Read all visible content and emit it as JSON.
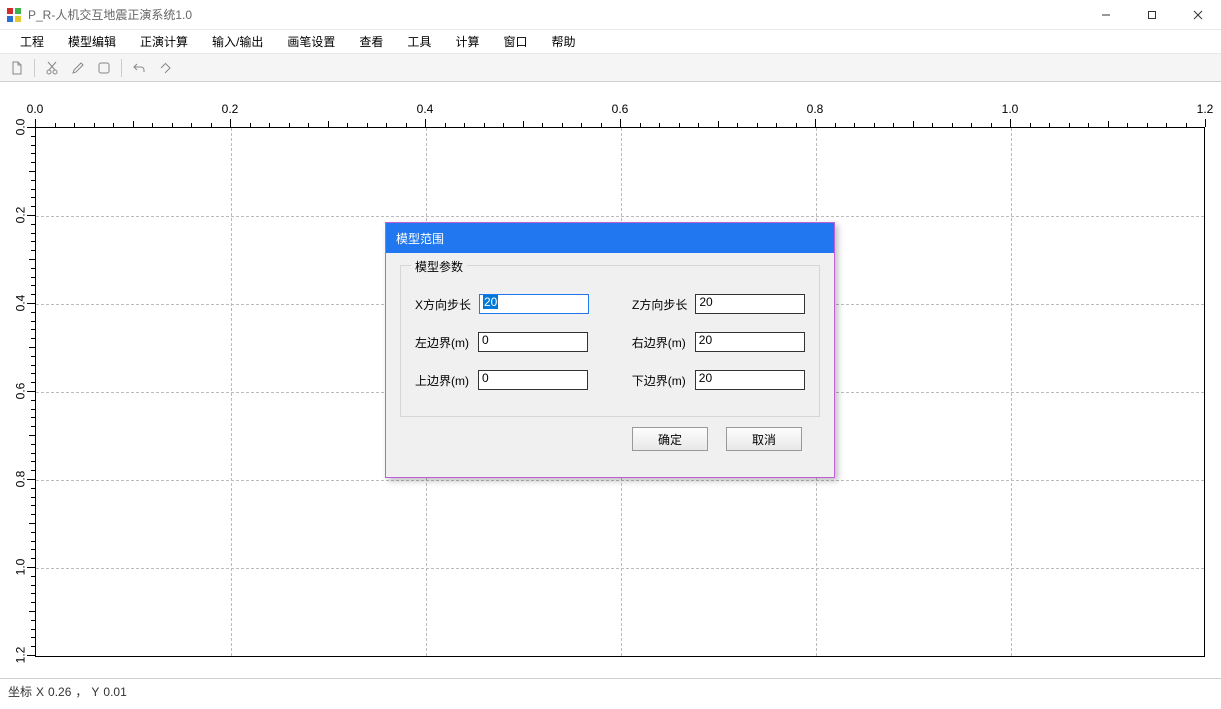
{
  "window": {
    "title": "P_R-人机交互地震正演系统1.0"
  },
  "menu": {
    "items": [
      "工程",
      "模型编辑",
      "正演计算",
      "输入/输出",
      "画笔设置",
      "查看",
      "工具",
      "计算",
      "窗口",
      "帮助"
    ]
  },
  "toolbar": {
    "icons": [
      "new-doc-icon",
      "cut-icon",
      "pencil-icon",
      "circle-icon",
      "undo-icon",
      "redo-brush-icon"
    ]
  },
  "plot": {
    "x_ticks": [
      "0.0",
      "0.2",
      "0.4",
      "0.6",
      "0.8",
      "1.0",
      "1.2"
    ],
    "y_ticks": [
      "0.0",
      "0.2",
      "0.4",
      "0.6",
      "0.8",
      "1.0",
      "1.2"
    ]
  },
  "dialog": {
    "title": "模型范围",
    "group_title": "模型参数",
    "fields": {
      "x_step_label": "X方向步长",
      "x_step_value": "20",
      "z_step_label": "Z方向步长",
      "z_step_value": "20",
      "left_label": "左边界(m)",
      "left_value": "0",
      "right_label": "右边界(m)",
      "right_value": "20",
      "top_label": "上边界(m)",
      "top_value": "0",
      "bottom_label": "下边界(m)",
      "bottom_value": "20"
    },
    "ok_label": "确定",
    "cancel_label": "取消"
  },
  "status": {
    "label": "坐标",
    "x_prefix": "X",
    "x_value": "0.26",
    "sep": "，",
    "y_prefix": "Y",
    "y_value": "0.01"
  }
}
